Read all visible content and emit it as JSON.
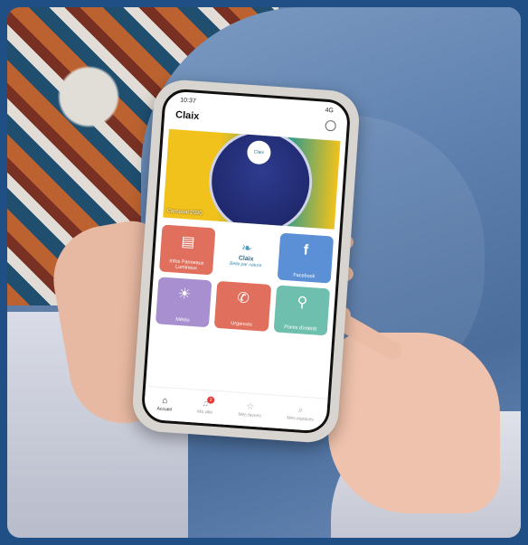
{
  "status_bar": {
    "time": "10:37",
    "signal": "4G"
  },
  "app": {
    "title": "Claix"
  },
  "banner": {
    "caption": "Carnaval 2020",
    "logo_text": "Claix"
  },
  "tiles": [
    {
      "label": "Infos Panneaux Lumineux",
      "color": "#e0705d",
      "icon": "sign-icon"
    },
    {
      "label": "Claix",
      "subtitle": "Belle par nature",
      "color": "#ffffff",
      "icon": "logo-icon"
    },
    {
      "label": "Facebook",
      "color": "#5b8fd6",
      "icon": "facebook-icon"
    },
    {
      "label": "Météo",
      "color": "#a78fd0",
      "icon": "sun-icon"
    },
    {
      "label": "Urgences",
      "color": "#e0705d",
      "icon": "phone-icon"
    },
    {
      "label": "Points d'intérêt",
      "color": "#6fbfae",
      "icon": "pin-icon"
    }
  ],
  "tabs": [
    {
      "label": "Accueil",
      "icon": "home-icon",
      "active": true
    },
    {
      "label": "Ma ville",
      "icon": "bell-icon",
      "badge": "2"
    },
    {
      "label": "Mes favoris",
      "icon": "star-icon"
    },
    {
      "label": "Mes espaces",
      "icon": "search-icon"
    }
  ]
}
